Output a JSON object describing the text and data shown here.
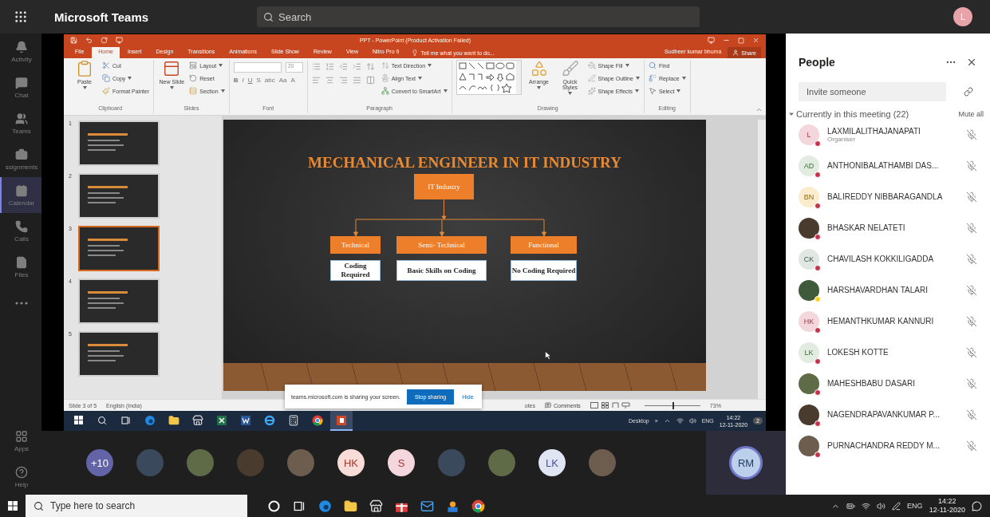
{
  "teams": {
    "title": "Microsoft Teams",
    "search_placeholder": "Search",
    "account_initial": "L"
  },
  "rail": [
    {
      "kind": "activity",
      "label": "Activity",
      "selected": false
    },
    {
      "kind": "chat",
      "label": "Chat",
      "selected": false
    },
    {
      "kind": "teams",
      "label": "Teams",
      "selected": false
    },
    {
      "kind": "assignments",
      "label": "ssignments",
      "selected": false
    },
    {
      "kind": "calendar",
      "label": "Calendar",
      "selected": true
    },
    {
      "kind": "calls",
      "label": "Calls",
      "selected": false
    },
    {
      "kind": "files",
      "label": "Files",
      "selected": false
    },
    {
      "kind": "more",
      "selected": false
    }
  ],
  "rail_bottom": [
    {
      "kind": "apps",
      "label": "Apps"
    },
    {
      "kind": "help",
      "label": "Help"
    }
  ],
  "powerpoint": {
    "title": "PPT - PowerPoint (Product Activation Failed)",
    "tell_me": "Tell me what you want to do...",
    "user": "Sudheer kumar bhuma",
    "share": "Share",
    "tabs": [
      {
        "label": "File",
        "selected": false
      },
      {
        "label": "Home",
        "selected": true
      },
      {
        "label": "Insert",
        "selected": false
      },
      {
        "label": "Design",
        "selected": false
      },
      {
        "label": "Transitions",
        "selected": false
      },
      {
        "label": "Animations",
        "selected": false
      },
      {
        "label": "Slide Show",
        "selected": false
      },
      {
        "label": "Review",
        "selected": false
      },
      {
        "label": "View",
        "selected": false
      },
      {
        "label": "Nitro Pro 9",
        "selected": false
      }
    ],
    "ribbon": [
      {
        "name": "Clipboard",
        "commands": [
          {
            "kind": "large",
            "label": "Paste",
            "dropdown": true
          },
          {
            "kind": "small",
            "label": "Cut",
            "dropdown": false
          },
          {
            "kind": "small",
            "label": "Copy",
            "dropdown": true
          },
          {
            "kind": "small",
            "label": "Format Painter",
            "dropdown": false
          }
        ]
      },
      {
        "name": "Slides",
        "commands": [
          {
            "kind": "large",
            "label": "New Slide",
            "dropdown": true
          },
          {
            "kind": "small",
            "label": "Layout",
            "dropdown": true
          },
          {
            "kind": "small",
            "label": "Reset",
            "dropdown": false
          },
          {
            "kind": "small",
            "label": "Section",
            "dropdown": true
          }
        ]
      },
      {
        "name": "Font",
        "commands": [
          {
            "kind": "font",
            "size": "20",
            "glyphs": [
              "B",
              "I",
              "U",
              "S",
              "abc",
              "Aa",
              "A"
            ]
          }
        ]
      },
      {
        "name": "Paragraph",
        "commands": [
          {
            "kind": "paragraph-icons"
          },
          {
            "kind": "small",
            "label": "Text Direction",
            "dropdown": true
          },
          {
            "kind": "small",
            "label": "Align Text",
            "dropdown": true
          },
          {
            "kind": "small",
            "label": "Convert to SmartArt",
            "dropdown": true
          }
        ]
      },
      {
        "name": "Drawing",
        "commands": [
          {
            "kind": "gallery"
          },
          {
            "kind": "large",
            "label": "Arrange",
            "dropdown": true
          },
          {
            "kind": "large",
            "label": "Quick Styles",
            "dropdown": true
          },
          {
            "kind": "small",
            "label": "Shape Fill",
            "dropdown": true
          },
          {
            "kind": "small",
            "label": "Shape Outline",
            "dropdown": true
          },
          {
            "kind": "small",
            "label": "Shape Effects",
            "dropdown": true
          }
        ]
      },
      {
        "name": "Editing",
        "commands": [
          {
            "kind": "small",
            "label": "Find",
            "dropdown": false
          },
          {
            "kind": "small",
            "label": "Replace",
            "dropdown": true
          },
          {
            "kind": "small",
            "label": "Select",
            "dropdown": true
          }
        ]
      }
    ],
    "thumbnails": [
      {
        "number": "1",
        "selected": false
      },
      {
        "number": "2",
        "selected": false
      },
      {
        "number": "3",
        "selected": true
      },
      {
        "number": "4",
        "selected": false
      },
      {
        "number": "5",
        "selected": false
      }
    ],
    "slide": {
      "title": "MECHANICAL ENGINEER IN IT INDUSTRY",
      "root": "IT Industry",
      "branches": [
        {
          "label": "Technical",
          "detail": "Coding Required"
        },
        {
          "label": "Semi- Technical",
          "detail": "Basic Skills on Coding"
        },
        {
          "label": "Functional",
          "detail": "No Coding Required"
        }
      ]
    },
    "status_bar": {
      "slide_info": "Slide 3 of 5",
      "language": "English (India)",
      "notes": "otes",
      "comments": "Comments",
      "zoom": "73%",
      "level": 0.5
    }
  },
  "sharing_banner": {
    "message": "teams.microsoft.com is sharing your screen.",
    "stop": "Stop sharing",
    "hide": "Hide"
  },
  "shared_taskbar": {
    "apps": [
      {
        "kind": "start",
        "selected": false
      },
      {
        "kind": "search",
        "selected": false
      },
      {
        "kind": "taskview",
        "selected": false
      },
      {
        "kind": "edge",
        "selected": false
      },
      {
        "kind": "explorer",
        "selected": false
      },
      {
        "kind": "store",
        "selected": false
      },
      {
        "kind": "excel",
        "selected": false
      },
      {
        "kind": "word",
        "selected": false
      },
      {
        "kind": "ie",
        "selected": false
      },
      {
        "kind": "calculator",
        "selected": false
      },
      {
        "kind": "chrome",
        "selected": false
      },
      {
        "kind": "powerpoint",
        "selected": true
      }
    ],
    "desktop": "Desktop",
    "overflow": "»",
    "language": "ENG",
    "time": "14:22",
    "date": "12-11-2020",
    "notifications": "2"
  },
  "call_strip": {
    "participants": [
      {
        "kind": "more",
        "label": "+10"
      },
      {
        "kind": "photo"
      },
      {
        "kind": "photo"
      },
      {
        "kind": "photo"
      },
      {
        "kind": "photo"
      },
      {
        "kind": "initials",
        "label": "HK"
      },
      {
        "kind": "initials",
        "label": "S"
      },
      {
        "kind": "photo"
      },
      {
        "kind": "photo"
      },
      {
        "kind": "initials",
        "label": "LK"
      },
      {
        "kind": "photo"
      }
    ],
    "self": "RM"
  },
  "people": {
    "title": "People",
    "invite_placeholder": "Invite someone",
    "section": "Currently in this meeting (22)",
    "expanded": true,
    "mute_all": "Mute all",
    "members": [
      {
        "name": "LAXMILALITHAJANAPATI",
        "role": "Organiser",
        "kind": "initials",
        "initials": "L",
        "color": "#c4314b"
      },
      {
        "name": "ANTHONIBALATHAMBI DAS...",
        "kind": "initials",
        "initials": "AD",
        "color": "#c4314b"
      },
      {
        "name": "BALIREDDY NIBBARAGANDLA",
        "kind": "initials",
        "initials": "BN",
        "color": "#c4314b"
      },
      {
        "name": "BHASKAR NELATETI",
        "kind": "photo",
        "color": "#c4314b"
      },
      {
        "name": "CHAVILASH KOKKILIGADDA",
        "kind": "initials",
        "initials": "CK",
        "color": "#c4314b"
      },
      {
        "name": "HARSHAVARDHAN TALARI",
        "kind": "photo",
        "color": "#f8d22a"
      },
      {
        "name": "HEMANTHKUMAR KANNURI",
        "kind": "initials",
        "initials": "HK",
        "color": "#c4314b"
      },
      {
        "name": "LOKESH KOTTE",
        "kind": "initials",
        "initials": "LK",
        "color": "#c4314b"
      },
      {
        "name": "MAHESHBABU DASARI",
        "kind": "photo",
        "color": "#c4314b"
      },
      {
        "name": "NAGENDRAPAVANKUMAR P...",
        "kind": "photo",
        "color": "#c4314b"
      },
      {
        "name": "PURNACHANDRA REDDY M...",
        "kind": "photo",
        "color": "#c4314b"
      }
    ]
  },
  "windows_taskbar": {
    "search_placeholder": "Type here to search",
    "apps": [
      {
        "kind": "cortana"
      },
      {
        "kind": "taskview"
      },
      {
        "kind": "edge"
      },
      {
        "kind": "explorer"
      },
      {
        "kind": "store"
      },
      {
        "kind": "office"
      },
      {
        "kind": "mail"
      },
      {
        "kind": "app"
      },
      {
        "kind": "chrome"
      }
    ],
    "language": "ENG",
    "time": "14:22",
    "date": "12-11-2020"
  }
}
